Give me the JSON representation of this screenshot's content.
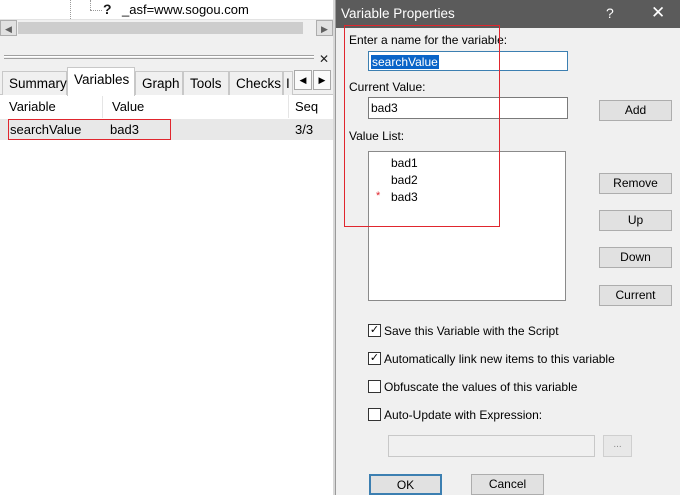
{
  "tree": {
    "node_icon": "question-icon",
    "node_label": "_asf=www.sogou.com"
  },
  "tabs": [
    {
      "label": "Summary"
    },
    {
      "label": "Variables"
    },
    {
      "label": "Graph"
    },
    {
      "label": "Tools"
    },
    {
      "label": "Checks"
    },
    {
      "label": "I"
    }
  ],
  "active_tab": "Variables",
  "variables_table": {
    "columns": [
      "Variable",
      "Value",
      "Seq"
    ],
    "rows": [
      {
        "variable": "searchValue",
        "value": "bad3",
        "seq": "3/3"
      }
    ]
  },
  "dialog": {
    "title": "Variable Properties",
    "help_label": "?",
    "close_label": "✕",
    "name_label": "Enter a name for the variable:",
    "name_value": "searchValue",
    "current_label": "Current Value:",
    "current_value": "bad3",
    "list_label": "Value List:",
    "value_list": [
      "bad1",
      "bad2",
      "bad3"
    ],
    "current_marker": "*",
    "buttons": {
      "add": "Add",
      "remove": "Remove",
      "up": "Up",
      "down": "Down",
      "current": "Current",
      "ok": "OK",
      "cancel": "Cancel",
      "browse": "..."
    },
    "checkboxes": [
      {
        "label": "Save this Variable with the Script",
        "checked": true
      },
      {
        "label": "Automatically link new items to this variable",
        "checked": true
      },
      {
        "label": "Obfuscate the values of this variable",
        "checked": false
      },
      {
        "label": "Auto-Update with Expression:",
        "checked": false
      }
    ],
    "expression_value": ""
  },
  "colors": {
    "titlebar": "#5b5b5b",
    "highlight_border": "#e0262e",
    "selection": "#0a64c8"
  }
}
